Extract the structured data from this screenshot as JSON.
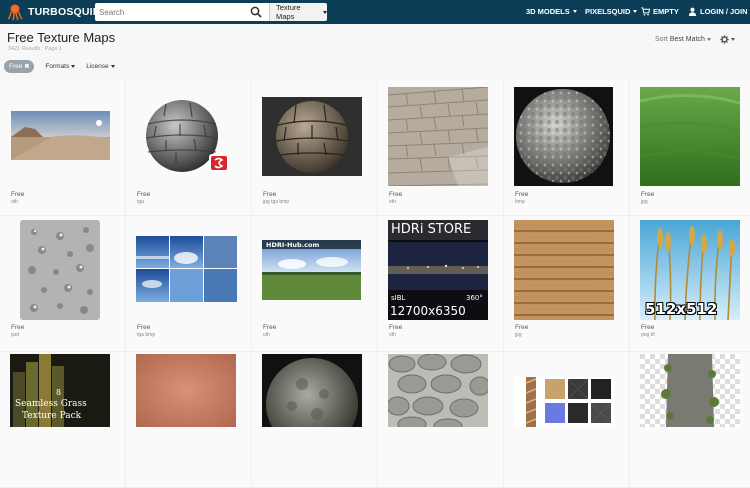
{
  "header": {
    "logo_text": "TURBOSQUID",
    "search_placeholder": "Search",
    "search_category": "Texture Maps",
    "nav": {
      "models": "3D MODELS",
      "pixelsquid": "PIXELSQUID",
      "cart": "EMPTY",
      "login": "LOGIN / JOIN"
    }
  },
  "page": {
    "title": "Free Texture Maps",
    "results": "3421 Results : Page 1",
    "sort_label": "Sort",
    "sort_value": "Best Match"
  },
  "filters": {
    "active_chip": "Free",
    "formats": "Formats",
    "license": "License"
  },
  "products": [
    {
      "price": "Free",
      "formats": "oth"
    },
    {
      "price": "Free",
      "formats": "tga"
    },
    {
      "price": "Free",
      "formats": "jpg tga bmp"
    },
    {
      "price": "Free",
      "formats": "oth"
    },
    {
      "price": "Free",
      "formats": "bmp"
    },
    {
      "price": "Free",
      "formats": "jpg"
    },
    {
      "price": "Free",
      "formats": "psd"
    },
    {
      "price": "Free",
      "formats": "tga bmp"
    },
    {
      "price": "Free",
      "formats": "oth"
    },
    {
      "price": "Free",
      "formats": "oth"
    },
    {
      "price": "Free",
      "formats": "jpg"
    },
    {
      "price": "Free",
      "formats": "png tif"
    }
  ],
  "thumb_text": {
    "hdri_hub": "HDRI-Hub.com",
    "hdri_store": "HDRi STORE",
    "sibl": "sIBL",
    "deg": "360°",
    "res": "12700x6350",
    "wheat_res": "512x512",
    "grass_num": "8",
    "grass_title1": "Seamless Grass",
    "grass_title2": "Texture Pack"
  },
  "colors": {
    "nav_bg": "#0c3e57",
    "page_bg": "#f7f7f7",
    "chip_bg": "#9aa3aa"
  }
}
